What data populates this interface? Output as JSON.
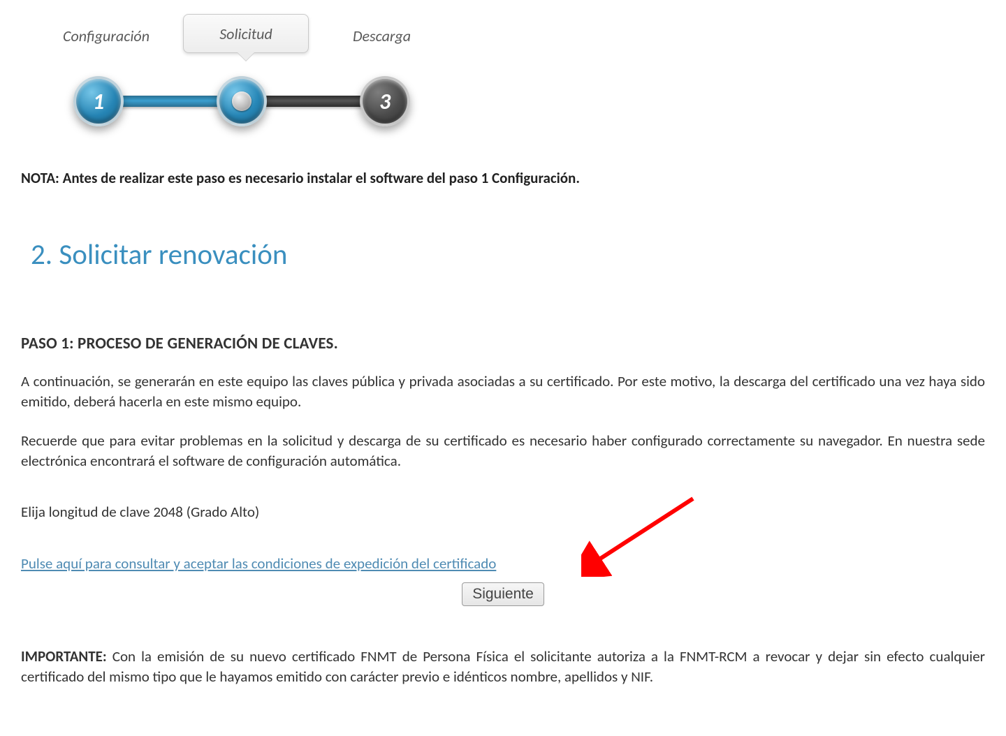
{
  "stepper": {
    "steps": {
      "s1": {
        "label": "Configuración",
        "number": "1"
      },
      "s2": {
        "label": "Solicitud",
        "number": ""
      },
      "s3": {
        "label": "Descarga",
        "number": "3"
      }
    }
  },
  "nota": {
    "label": "NOTA:",
    "text": "Antes de realizar este paso es necesario instalar el software del paso 1 Configuración."
  },
  "heading": "2. Solicitar renovación",
  "paso1": {
    "title": "PASO 1: PROCESO DE GENERACIÓN DE CLAVES.",
    "p1": "A continuación, se generarán en este equipo las claves pública y privada asociadas a su certificado. Por este motivo, la descarga del certificado una vez haya sido emitido, deberá hacerla en este mismo equipo.",
    "p2": "Recuerde que para evitar problemas en la solicitud y descarga de su certificado es necesario haber configurado correctamente su navegador. En nuestra sede electrónica encontrará el software de configuración automática.",
    "key_length": "Elija longitud de clave 2048  (Grado Alto)",
    "conditions_link": "Pulse aquí para consultar y aceptar las condiciones de expedición del certificado"
  },
  "buttons": {
    "next": "Siguiente"
  },
  "importante": {
    "label": "IMPORTANTE:",
    "text": "Con la emisión de su nuevo certificado FNMT de Persona Física el solicitante autoriza a la FNMT-RCM a revocar y dejar sin efecto cualquier certificado del mismo tipo que le hayamos emitido con carácter previo e idénticos nombre, apellidos y NIF."
  },
  "annotation": {
    "arrow_color": "#ff0000"
  }
}
